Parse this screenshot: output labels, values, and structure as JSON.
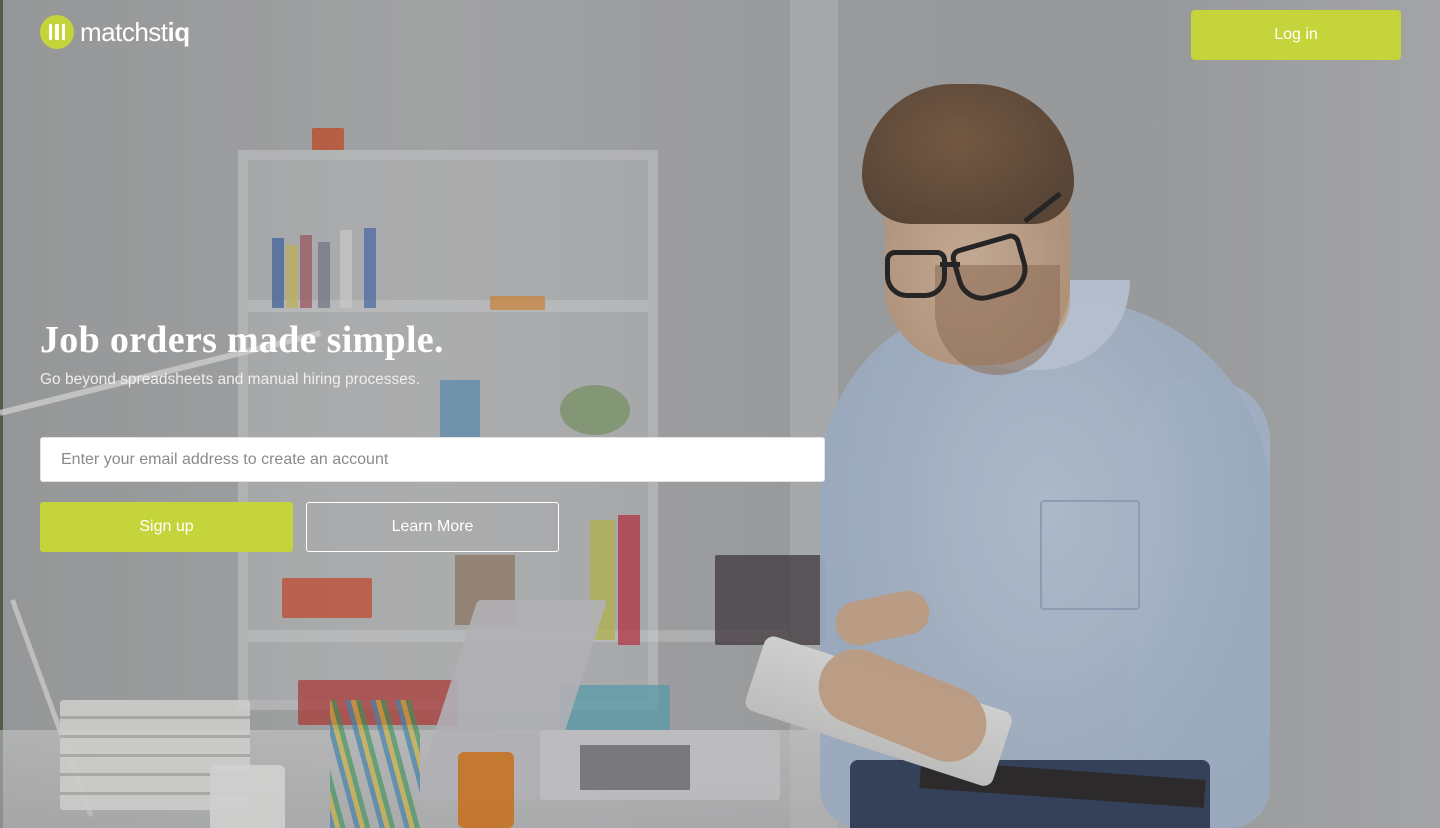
{
  "brand": {
    "logo_text_regular": "matchst",
    "logo_text_bold": "iq",
    "accent_color": "#c6d43b",
    "logo_icon": "matchstick-logo-icon"
  },
  "header": {
    "login_label": "Log in"
  },
  "hero": {
    "title": "Job orders made simple.",
    "subtitle": "Go beyond spreadsheets and manual hiring processes.",
    "email_placeholder": "Enter your email address to create an account",
    "signup_label": "Sign up",
    "learn_more_label": "Learn More"
  }
}
